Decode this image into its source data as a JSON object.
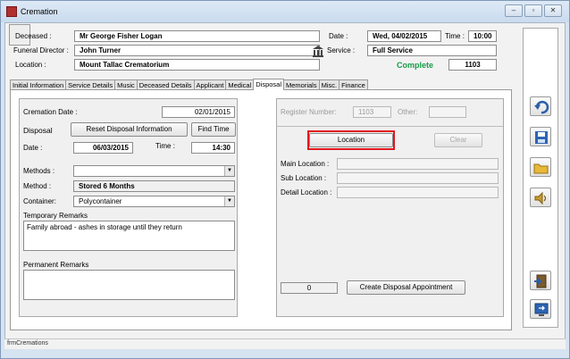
{
  "window": {
    "title": "Cremation",
    "minimize": "–",
    "restore": "▫",
    "close": "✕"
  },
  "header": {
    "deceased_label": "Deceased :",
    "deceased_value": "Mr George Fisher Logan",
    "funeral_director_label": "Funeral Director :",
    "funeral_director_value": "John Turner",
    "location_label": "Location :",
    "location_value": "Mount Tallac Crematorium",
    "date_label": "Date :",
    "date_value": "Wed, 04/02/2015",
    "time_label": "Time :",
    "time_value": "10:00",
    "service_label": "Service :",
    "service_value": "Full Service",
    "status": "Complete",
    "record_number": "1103"
  },
  "tabs": [
    {
      "label": "Initial Information"
    },
    {
      "label": "Service Details"
    },
    {
      "label": "Music"
    },
    {
      "label": "Deceased Details"
    },
    {
      "label": "Applicant"
    },
    {
      "label": "Medical"
    },
    {
      "label": "Disposal"
    },
    {
      "label": "Memorials"
    },
    {
      "label": "Misc."
    },
    {
      "label": "Finance"
    }
  ],
  "disposal": {
    "cremation_date_label": "Cremation Date :",
    "cremation_date_value": "02/01/2015",
    "disposal_label": "Disposal",
    "reset_button": "Reset Disposal Information",
    "find_time_button": "Find Time",
    "date_label": "Date :",
    "date_value": "06/03/2015",
    "time_label": "Time :",
    "time_value": "14:30",
    "methods_label": "Methods :",
    "methods_value": "",
    "method_label": "Method :",
    "method_value": "Stored 6 Months",
    "container_label": "Container:",
    "container_value": "Polycontainer",
    "temp_remarks_label": "Temporary Remarks",
    "temp_remarks_value": "Family abroad - ashes in storage until they return",
    "perm_remarks_label": "Permanent Remarks",
    "perm_remarks_value": ""
  },
  "register": {
    "register_number_label": "Register Number:",
    "register_number_value": "1103",
    "other_label": "Other:",
    "other_value": "",
    "location_button": "Location",
    "clear_button": "Clear",
    "main_location_label": "Main Location :",
    "sub_location_label": "Sub Location :",
    "detail_location_label": "Detail Location :",
    "count_value": "0",
    "create_appointment_button": "Create Disposal Appointment"
  },
  "sidebar_icons": [
    "undo-icon",
    "save-icon",
    "folder-icon",
    "speaker-icon",
    "exit-door-icon",
    "monitor-exit-icon"
  ],
  "statusbar": {
    "text": "frmCremations"
  },
  "colors": {
    "status_complete": "#1a9a4a",
    "highlight": "#e0171f"
  }
}
